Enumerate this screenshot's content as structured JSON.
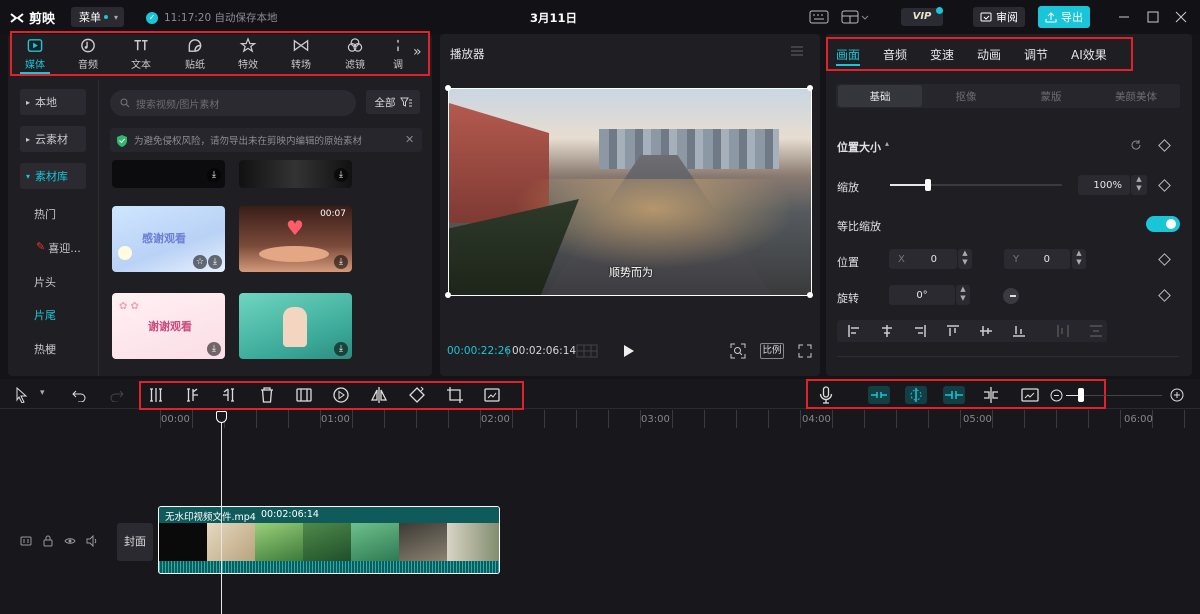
{
  "app": {
    "name": "剪映",
    "menu_label": "菜单",
    "autosave": "11:17:20 自动保存本地",
    "project_title": "3月11日",
    "vip_label": "VIP",
    "review_label": "审阅",
    "export_label": "导出"
  },
  "media_tabs": [
    {
      "label": "媒体",
      "icon": "media-icon"
    },
    {
      "label": "音频",
      "icon": "audio-icon"
    },
    {
      "label": "文本",
      "icon": "text-icon"
    },
    {
      "label": "贴纸",
      "icon": "sticker-icon"
    },
    {
      "label": "特效",
      "icon": "effects-icon"
    },
    {
      "label": "转场",
      "icon": "transition-icon"
    },
    {
      "label": "滤镜",
      "icon": "filter-icon"
    },
    {
      "label": "调",
      "icon": "adjust-icon"
    }
  ],
  "sidebar": {
    "local": "本地",
    "cloud": "云素材",
    "library": "素材库",
    "sub_items": [
      "热门",
      "喜迎...",
      "片头",
      "片尾",
      "热梗"
    ],
    "active_sub": "片尾"
  },
  "search": {
    "placeholder": "搜索视频/图片素材",
    "filter_label": "全部"
  },
  "notice": "为避免侵权风险，请勿导出未在剪映内编辑的原始素材",
  "thumbs": [
    {
      "text": "感谢观看",
      "duration": ""
    },
    {
      "text": "",
      "duration": "00:07"
    },
    {
      "text": "谢谢观看",
      "duration": ""
    },
    {
      "text": "",
      "duration": ""
    }
  ],
  "player": {
    "title": "播放器",
    "caption": "顺势而为",
    "current_time": "00:00:22:26",
    "total_time": "00:02:06:14",
    "ratio_label": "比例"
  },
  "properties": {
    "tabs": [
      "画面",
      "音频",
      "变速",
      "动画",
      "调节",
      "AI效果"
    ],
    "subtabs": [
      "基础",
      "抠像",
      "蒙版",
      "美颜美体"
    ],
    "section": "位置大小",
    "scale_label": "缩放",
    "scale_value": "100%",
    "scale_fraction": 0.22,
    "uniform_label": "等比缩放",
    "position_label": "位置",
    "pos_x_label": "X",
    "pos_x": "0",
    "pos_y_label": "Y",
    "pos_y": "0",
    "rotate_label": "旋转",
    "rotate_value": "0°"
  },
  "timeline": {
    "ruler": [
      "00:00",
      "01:00",
      "02:00",
      "03:00",
      "04:00",
      "05:00",
      "06:00"
    ],
    "cover_label": "封面",
    "clip_name": "无水印视频文件.mp4",
    "clip_duration": "00:02:06:14"
  },
  "colors": {
    "accent": "#19c5d6",
    "highlight": "#e2222a"
  }
}
